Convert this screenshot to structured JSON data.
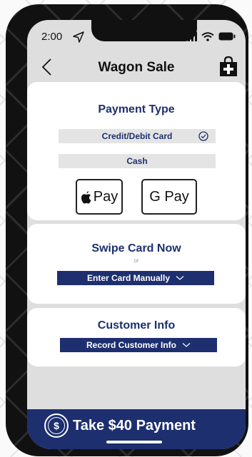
{
  "status_bar": {
    "time": "2:00"
  },
  "header": {
    "title": "Wagon Sale",
    "back_icon": "chevron-left-icon",
    "cart_icon": "add-to-cart-icon"
  },
  "payment_type": {
    "title": "Payment Type",
    "options": [
      {
        "label": "Credit/Debit Card",
        "selected": true
      },
      {
        "label": "Cash",
        "selected": false
      }
    ],
    "wallets": {
      "apple_pay": "Pay",
      "google_pay": "G Pay"
    }
  },
  "swipe": {
    "title": "Swipe Card Now",
    "or_text": "or",
    "enter_manually_label": "Enter Card Manually"
  },
  "customer": {
    "title": "Customer Info",
    "record_label": "Record Customer Info"
  },
  "footer": {
    "pay_label": "Take $40 Payment",
    "dollar_symbol": "$"
  },
  "colors": {
    "navy": "#1d2f6f",
    "option_bg": "#e4e4e4",
    "screen_bg": "#dedede"
  }
}
